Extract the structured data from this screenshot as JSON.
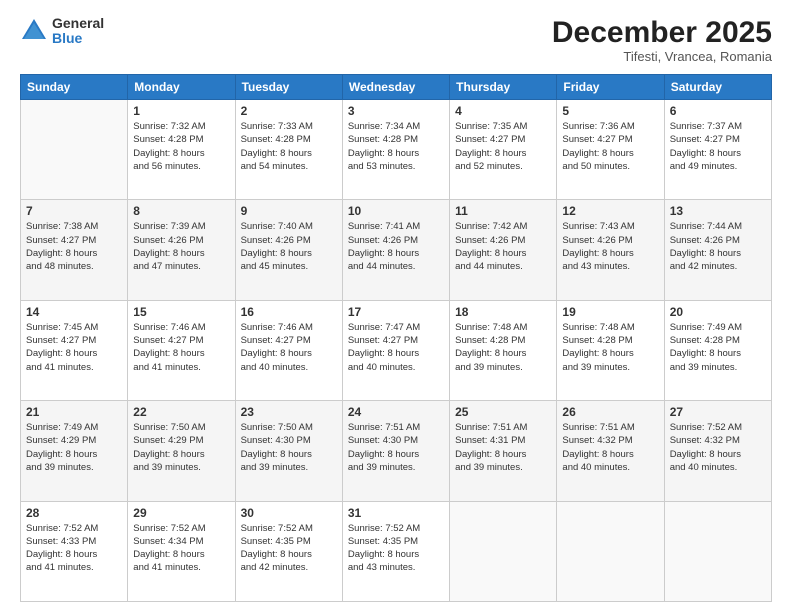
{
  "header": {
    "logo": {
      "general": "General",
      "blue": "Blue"
    },
    "title": "December 2025",
    "subtitle": "Tifesti, Vrancea, Romania"
  },
  "weekdays": [
    "Sunday",
    "Monday",
    "Tuesday",
    "Wednesday",
    "Thursday",
    "Friday",
    "Saturday"
  ],
  "weeks": [
    [
      {
        "day": "",
        "info": ""
      },
      {
        "day": "1",
        "info": "Sunrise: 7:32 AM\nSunset: 4:28 PM\nDaylight: 8 hours\nand 56 minutes."
      },
      {
        "day": "2",
        "info": "Sunrise: 7:33 AM\nSunset: 4:28 PM\nDaylight: 8 hours\nand 54 minutes."
      },
      {
        "day": "3",
        "info": "Sunrise: 7:34 AM\nSunset: 4:28 PM\nDaylight: 8 hours\nand 53 minutes."
      },
      {
        "day": "4",
        "info": "Sunrise: 7:35 AM\nSunset: 4:27 PM\nDaylight: 8 hours\nand 52 minutes."
      },
      {
        "day": "5",
        "info": "Sunrise: 7:36 AM\nSunset: 4:27 PM\nDaylight: 8 hours\nand 50 minutes."
      },
      {
        "day": "6",
        "info": "Sunrise: 7:37 AM\nSunset: 4:27 PM\nDaylight: 8 hours\nand 49 minutes."
      }
    ],
    [
      {
        "day": "7",
        "info": "Sunrise: 7:38 AM\nSunset: 4:27 PM\nDaylight: 8 hours\nand 48 minutes."
      },
      {
        "day": "8",
        "info": "Sunrise: 7:39 AM\nSunset: 4:26 PM\nDaylight: 8 hours\nand 47 minutes."
      },
      {
        "day": "9",
        "info": "Sunrise: 7:40 AM\nSunset: 4:26 PM\nDaylight: 8 hours\nand 45 minutes."
      },
      {
        "day": "10",
        "info": "Sunrise: 7:41 AM\nSunset: 4:26 PM\nDaylight: 8 hours\nand 44 minutes."
      },
      {
        "day": "11",
        "info": "Sunrise: 7:42 AM\nSunset: 4:26 PM\nDaylight: 8 hours\nand 44 minutes."
      },
      {
        "day": "12",
        "info": "Sunrise: 7:43 AM\nSunset: 4:26 PM\nDaylight: 8 hours\nand 43 minutes."
      },
      {
        "day": "13",
        "info": "Sunrise: 7:44 AM\nSunset: 4:26 PM\nDaylight: 8 hours\nand 42 minutes."
      }
    ],
    [
      {
        "day": "14",
        "info": "Sunrise: 7:45 AM\nSunset: 4:27 PM\nDaylight: 8 hours\nand 41 minutes."
      },
      {
        "day": "15",
        "info": "Sunrise: 7:46 AM\nSunset: 4:27 PM\nDaylight: 8 hours\nand 41 minutes."
      },
      {
        "day": "16",
        "info": "Sunrise: 7:46 AM\nSunset: 4:27 PM\nDaylight: 8 hours\nand 40 minutes."
      },
      {
        "day": "17",
        "info": "Sunrise: 7:47 AM\nSunset: 4:27 PM\nDaylight: 8 hours\nand 40 minutes."
      },
      {
        "day": "18",
        "info": "Sunrise: 7:48 AM\nSunset: 4:28 PM\nDaylight: 8 hours\nand 39 minutes."
      },
      {
        "day": "19",
        "info": "Sunrise: 7:48 AM\nSunset: 4:28 PM\nDaylight: 8 hours\nand 39 minutes."
      },
      {
        "day": "20",
        "info": "Sunrise: 7:49 AM\nSunset: 4:28 PM\nDaylight: 8 hours\nand 39 minutes."
      }
    ],
    [
      {
        "day": "21",
        "info": "Sunrise: 7:49 AM\nSunset: 4:29 PM\nDaylight: 8 hours\nand 39 minutes."
      },
      {
        "day": "22",
        "info": "Sunrise: 7:50 AM\nSunset: 4:29 PM\nDaylight: 8 hours\nand 39 minutes."
      },
      {
        "day": "23",
        "info": "Sunrise: 7:50 AM\nSunset: 4:30 PM\nDaylight: 8 hours\nand 39 minutes."
      },
      {
        "day": "24",
        "info": "Sunrise: 7:51 AM\nSunset: 4:30 PM\nDaylight: 8 hours\nand 39 minutes."
      },
      {
        "day": "25",
        "info": "Sunrise: 7:51 AM\nSunset: 4:31 PM\nDaylight: 8 hours\nand 39 minutes."
      },
      {
        "day": "26",
        "info": "Sunrise: 7:51 AM\nSunset: 4:32 PM\nDaylight: 8 hours\nand 40 minutes."
      },
      {
        "day": "27",
        "info": "Sunrise: 7:52 AM\nSunset: 4:32 PM\nDaylight: 8 hours\nand 40 minutes."
      }
    ],
    [
      {
        "day": "28",
        "info": "Sunrise: 7:52 AM\nSunset: 4:33 PM\nDaylight: 8 hours\nand 41 minutes."
      },
      {
        "day": "29",
        "info": "Sunrise: 7:52 AM\nSunset: 4:34 PM\nDaylight: 8 hours\nand 41 minutes."
      },
      {
        "day": "30",
        "info": "Sunrise: 7:52 AM\nSunset: 4:35 PM\nDaylight: 8 hours\nand 42 minutes."
      },
      {
        "day": "31",
        "info": "Sunrise: 7:52 AM\nSunset: 4:35 PM\nDaylight: 8 hours\nand 43 minutes."
      },
      {
        "day": "",
        "info": ""
      },
      {
        "day": "",
        "info": ""
      },
      {
        "day": "",
        "info": ""
      }
    ]
  ]
}
